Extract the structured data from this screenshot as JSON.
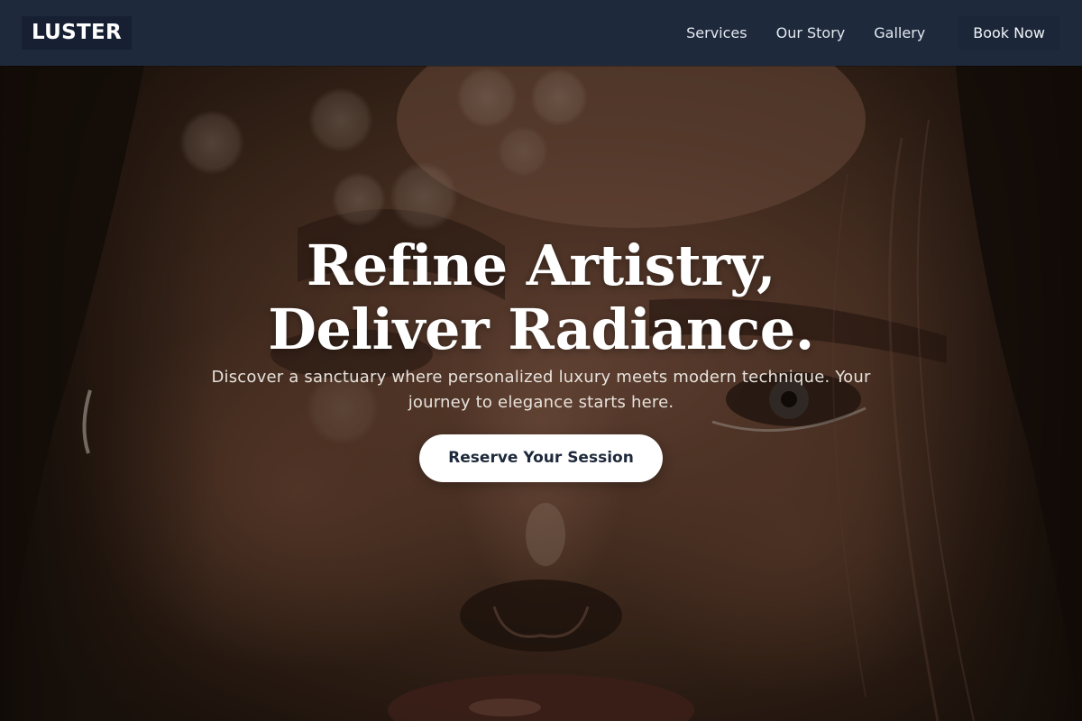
{
  "header": {
    "logo": "LUSTER",
    "nav": [
      "Services",
      "Our Story",
      "Gallery"
    ],
    "book_label": "Book Now"
  },
  "hero": {
    "headline_line1": "Refine Artistry,",
    "headline_line2": "Deliver Radiance.",
    "subtext": "Discover a sanctuary where personalized luxury meets modern technique. Your journey to elegance starts here.",
    "cta_label": "Reserve Your Session",
    "background_image": "close-up portrait of woman with freckles and nose ring"
  },
  "colors": {
    "header_bg": "#1e293b",
    "cta_bg": "#ffffff",
    "cta_text": "#1e293b"
  }
}
